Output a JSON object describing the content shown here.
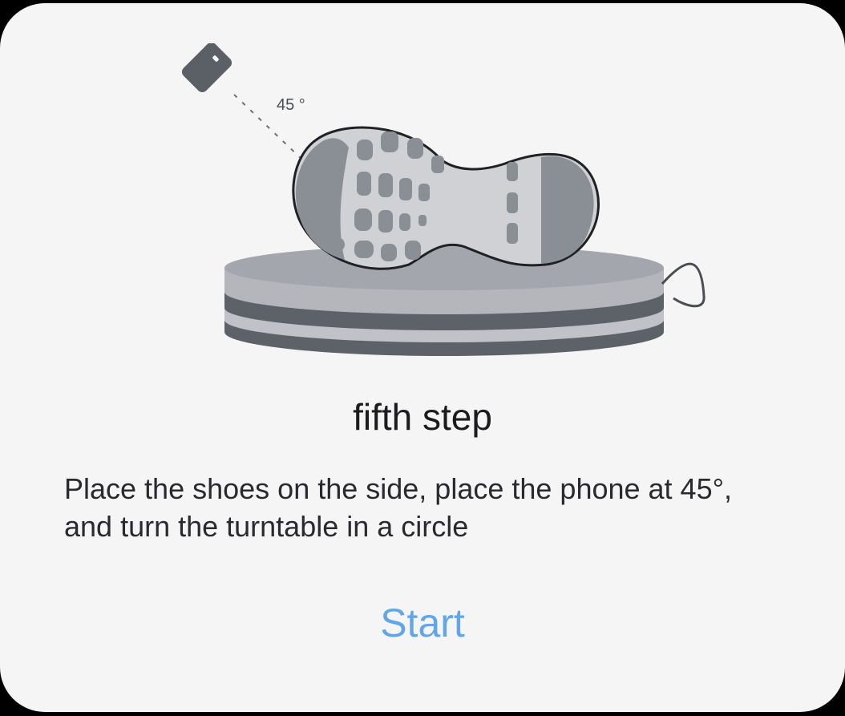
{
  "dialog": {
    "illustration": {
      "angle_label": "45 °"
    },
    "title": "fifth step",
    "description": "Place the shoes on the side, place the phone at 45°, and turn the turntable in a circle",
    "start_label": "Start"
  },
  "colors": {
    "background": "#f5f5f5",
    "title_text": "#1c1c1e",
    "body_text": "#2a2a2e",
    "accent": "#62a6e8",
    "illustration_dark": "#5b5f66",
    "illustration_mid": "#8c9199",
    "illustration_light": "#c7c9ce"
  }
}
